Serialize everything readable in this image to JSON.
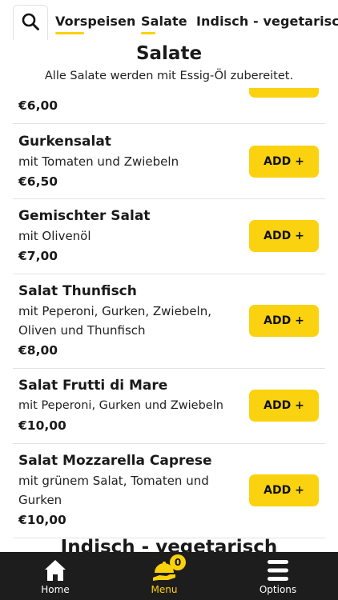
{
  "topbar": {
    "tabs": [
      "Vorspeisen",
      "Salate",
      "Indisch - vegetarisch"
    ]
  },
  "section": {
    "title": "Salate",
    "subtitle": "Alle Salate werden mit Essig-Öl zubereitet."
  },
  "partial_item": {
    "price": "€6,00"
  },
  "items": [
    {
      "name": "Gurkensalat",
      "desc": "mit Tomaten und Zwiebeln",
      "price": "€6,50",
      "add": "ADD +"
    },
    {
      "name": "Gemischter Salat",
      "desc": "mit Olivenöl",
      "price": "€7,00",
      "add": "ADD +"
    },
    {
      "name": "Salat Thunfisch",
      "desc": "mit Peperoni, Gurken, Zwiebeln, Oliven und Thunfisch",
      "price": "€8,00",
      "add": "ADD +"
    },
    {
      "name": "Salat Frutti di Mare",
      "desc": "mit Peperoni, Gurken und Zwiebeln",
      "price": "€10,00",
      "add": "ADD +"
    },
    {
      "name": "Salat Mozzarella Caprese",
      "desc": "mit grünem Salat, Tomaten und Gurken",
      "price": "€10,00",
      "add": "ADD +"
    }
  ],
  "next_section_title": "Indisch - vegetarisch",
  "bottom_nav": {
    "home": "Home",
    "menu": "Menu",
    "options": "Options",
    "cart_count": "0"
  },
  "colors": {
    "accent": "#fad210",
    "nav_bg": "#1e1d1d"
  },
  "icons": [
    "search-icon",
    "home-icon",
    "menu-cloche-icon",
    "hamburger-icon"
  ]
}
